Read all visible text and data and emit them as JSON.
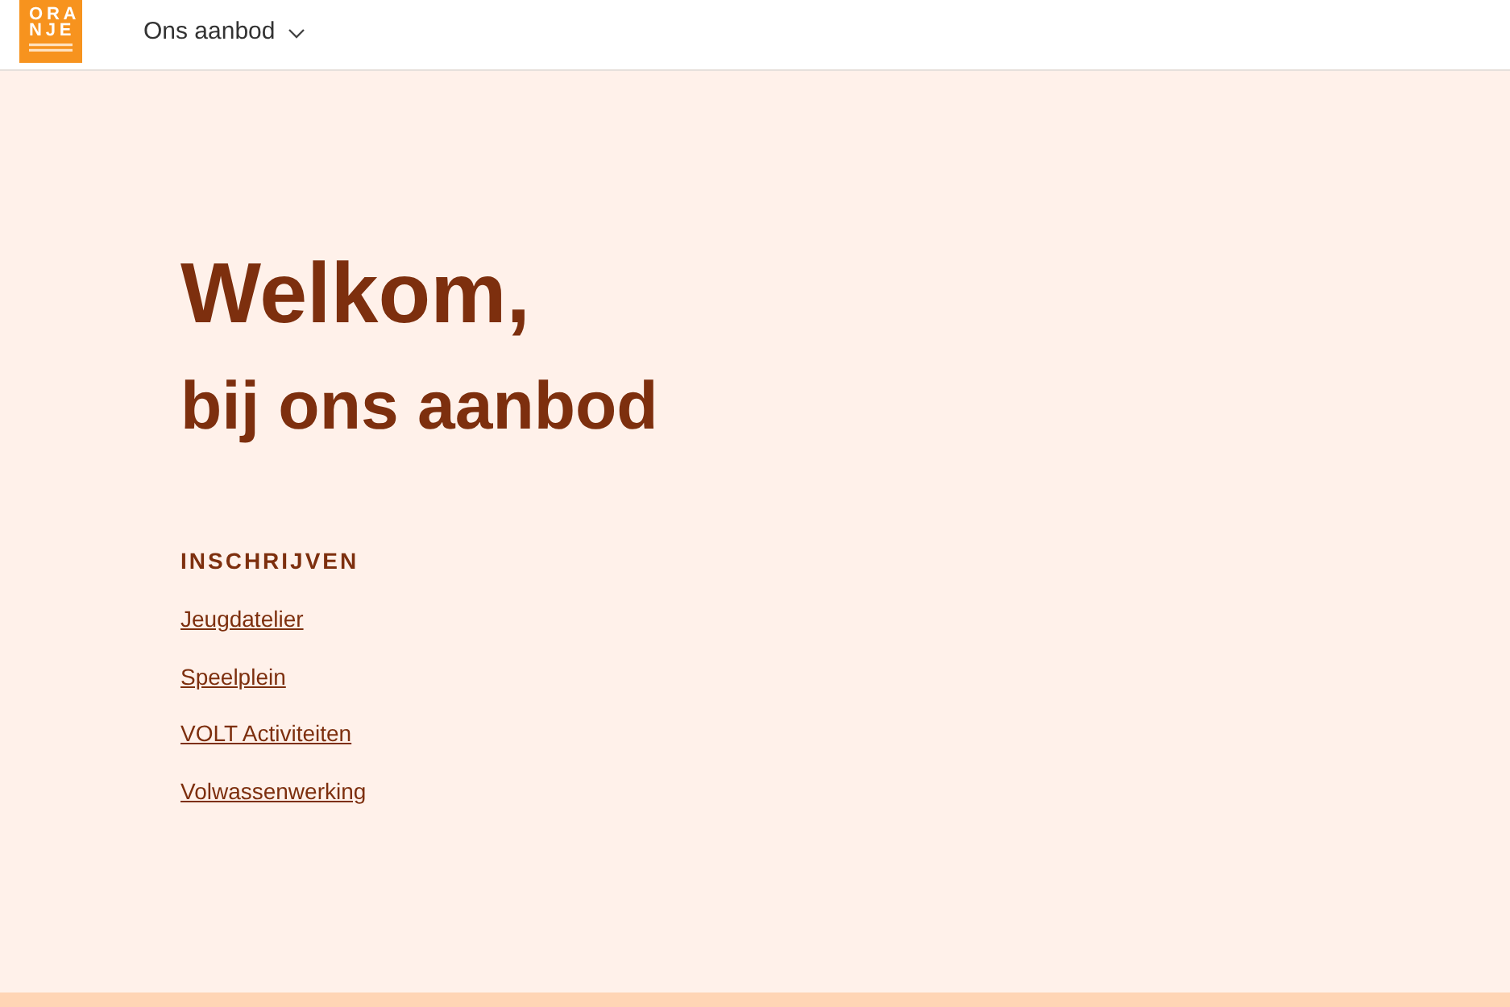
{
  "header": {
    "logo": {
      "lines": [
        "ORA",
        "NJE"
      ]
    },
    "nav": [
      {
        "label": "Ons aanbod",
        "expanded": false
      }
    ]
  },
  "hero": {
    "title": "Welkom,",
    "subtitle": "bij ons aanbod"
  },
  "signup": {
    "heading": "INSCHRIJVEN",
    "links": [
      "Jeugdatelier",
      "Speelplein",
      "VOLT Activiteiten",
      "Volwassenwerking"
    ]
  }
}
